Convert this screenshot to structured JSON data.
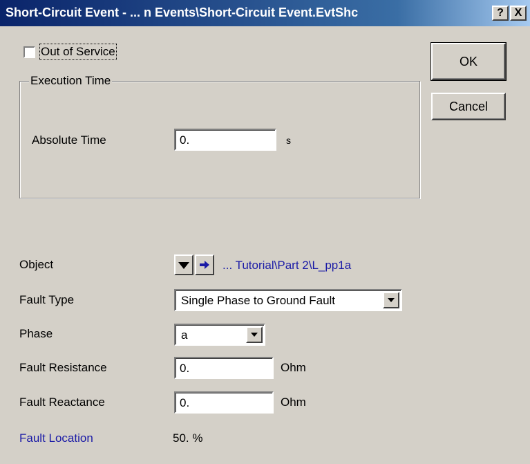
{
  "window": {
    "title": "Short-Circuit Event - ... n Events\\Short-Circuit Event.EvtShc",
    "help_label": "?",
    "close_label": "X"
  },
  "out_of_service": {
    "label": "Out of Service",
    "checked": false
  },
  "buttons": {
    "ok": "OK",
    "cancel": "Cancel"
  },
  "execution_time": {
    "group_label": "Execution Time",
    "absolute_time_label": "Absolute Time",
    "absolute_time_value": "0.",
    "absolute_time_unit": "s"
  },
  "object": {
    "label": "Object",
    "path": "... Tutorial\\Part 2\\L_pp1a",
    "select_icon": "down-triangle-icon",
    "jump_icon": "right-arrow-icon"
  },
  "fault_type": {
    "label": "Fault Type",
    "value": "Single Phase to Ground Fault"
  },
  "phase": {
    "label": "Phase",
    "value": "a"
  },
  "fault_resistance": {
    "label": "Fault Resistance",
    "value": "0.",
    "unit": "Ohm"
  },
  "fault_reactance": {
    "label": "Fault Reactance",
    "value": "0.",
    "unit": "Ohm"
  },
  "fault_location": {
    "label": "Fault Location",
    "value": "50. %"
  },
  "colors": {
    "link_blue": "#1a1aa6",
    "title_bar": "#0a246a",
    "dialog_bg": "#d4d0c8"
  }
}
